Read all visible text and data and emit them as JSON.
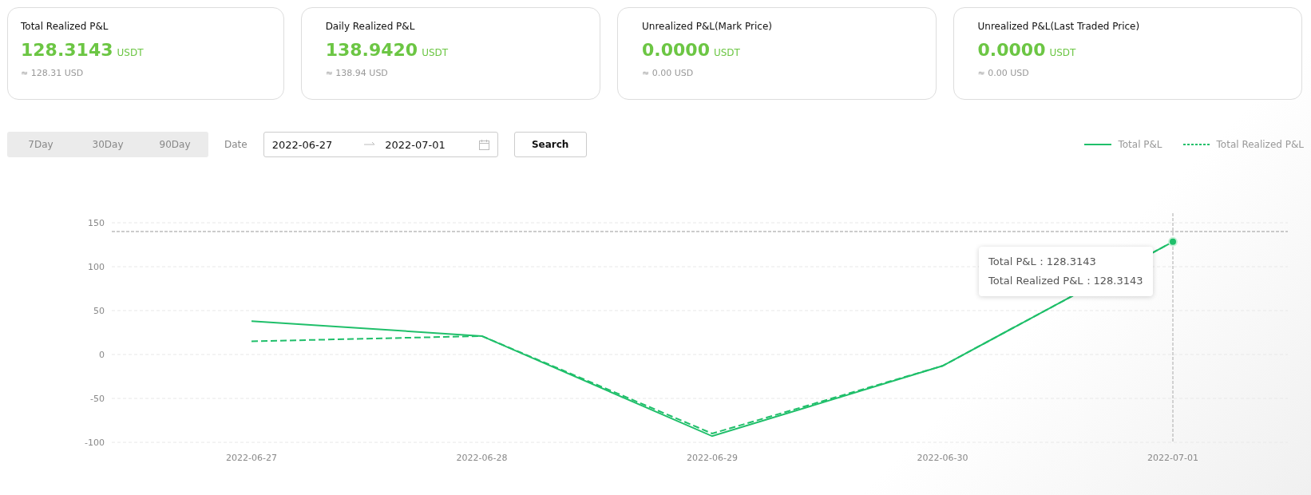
{
  "cards": [
    {
      "title": "Total Realized P&L",
      "value": "128.3143",
      "unit": "USDT",
      "approx": "≈ 128.31 USD"
    },
    {
      "title": "Daily Realized P&L",
      "value": "138.9420",
      "unit": "USDT",
      "approx": "≈ 138.94 USD"
    },
    {
      "title": "Unrealized P&L(Mark Price)",
      "value": "0.0000",
      "unit": "USDT",
      "approx": "≈ 0.00 USD"
    },
    {
      "title": "Unrealized P&L(Last Traded Price)",
      "value": "0.0000",
      "unit": "USDT",
      "approx": "≈ 0.00 USD"
    }
  ],
  "period_tabs": [
    {
      "label": "7Day",
      "selected": false
    },
    {
      "label": "30Day",
      "selected": false
    },
    {
      "label": "90Day",
      "selected": false
    }
  ],
  "date_label": "Date",
  "date_range": {
    "start": "2022-06-27",
    "end": "2022-07-01"
  },
  "search_button": "Search",
  "tooltip": {
    "lines": [
      "Total P&L：128.3143",
      "Total Realized P&L：128.3143"
    ]
  },
  "chart_data": {
    "type": "line",
    "grid": true,
    "ref_lines": [
      {
        "axis": "y",
        "value": 140
      },
      {
        "axis": "x",
        "value": "2022-07-01"
      }
    ],
    "categories": [
      "2022-06-27",
      "2022-06-28",
      "2022-06-29",
      "2022-06-30",
      "2022-07-01"
    ],
    "ylim": [
      -100,
      150
    ],
    "yticks": [
      -100,
      -50,
      0,
      50,
      100,
      150
    ],
    "series": [
      {
        "name": "Total P&L",
        "color": "#1fbf6a",
        "line_style": "solid",
        "values": [
          38,
          21,
          -93,
          -13,
          128.3
        ]
      },
      {
        "name": "Total Realized P&L",
        "color": "#1fbf6a",
        "line_style": "dashed",
        "values": [
          15,
          21,
          -90,
          -13,
          128.3
        ]
      }
    ]
  }
}
